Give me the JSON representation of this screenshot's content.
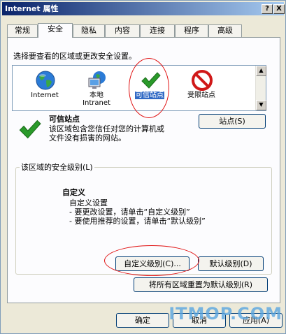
{
  "window": {
    "title": "Internet 属性",
    "help_btn": "?",
    "close_btn": "X"
  },
  "tabs": [
    {
      "label": "常规"
    },
    {
      "label": "安全"
    },
    {
      "label": "隐私"
    },
    {
      "label": "内容"
    },
    {
      "label": "连接"
    },
    {
      "label": "程序"
    },
    {
      "label": "高级"
    }
  ],
  "zones": {
    "prompt": "选择要查看的区域或更改安全设置。",
    "items": [
      {
        "name": "Internet",
        "icon": "globe-icon"
      },
      {
        "name": "本地\nIntranet",
        "icon": "intranet-monitor-icon"
      },
      {
        "name": "可信站点",
        "icon": "checkmark-icon",
        "selected": true
      },
      {
        "name": "受限站点",
        "icon": "no-entry-icon"
      }
    ]
  },
  "selected_zone": {
    "title": "可信站点",
    "description_1": "该区域包含您信任对您的计算机或",
    "description_2": "文件没有损害的网站。",
    "sites_button": "站点(S)"
  },
  "security_level": {
    "group_title": "该区域的安全级别(L)",
    "level_name": "自定义",
    "line_1": "自定义设置",
    "line_2": "- 要更改设置，请单击“自定义级别”",
    "line_3": "- 要使用推荐的设置，请单击“默认级别”",
    "custom_button": "自定义级别(C)...",
    "default_button": "默认级别(D)"
  },
  "reset_button": "将所有区域重置为默认级别(R)",
  "footer": {
    "ok": "确定",
    "cancel": "取消",
    "apply": "应用(A)"
  },
  "watermark": "ITMOP.COM",
  "colors": {
    "annotation": "#e01010",
    "check_green": "#2a9a2a",
    "titlebar": "#0a246a"
  }
}
